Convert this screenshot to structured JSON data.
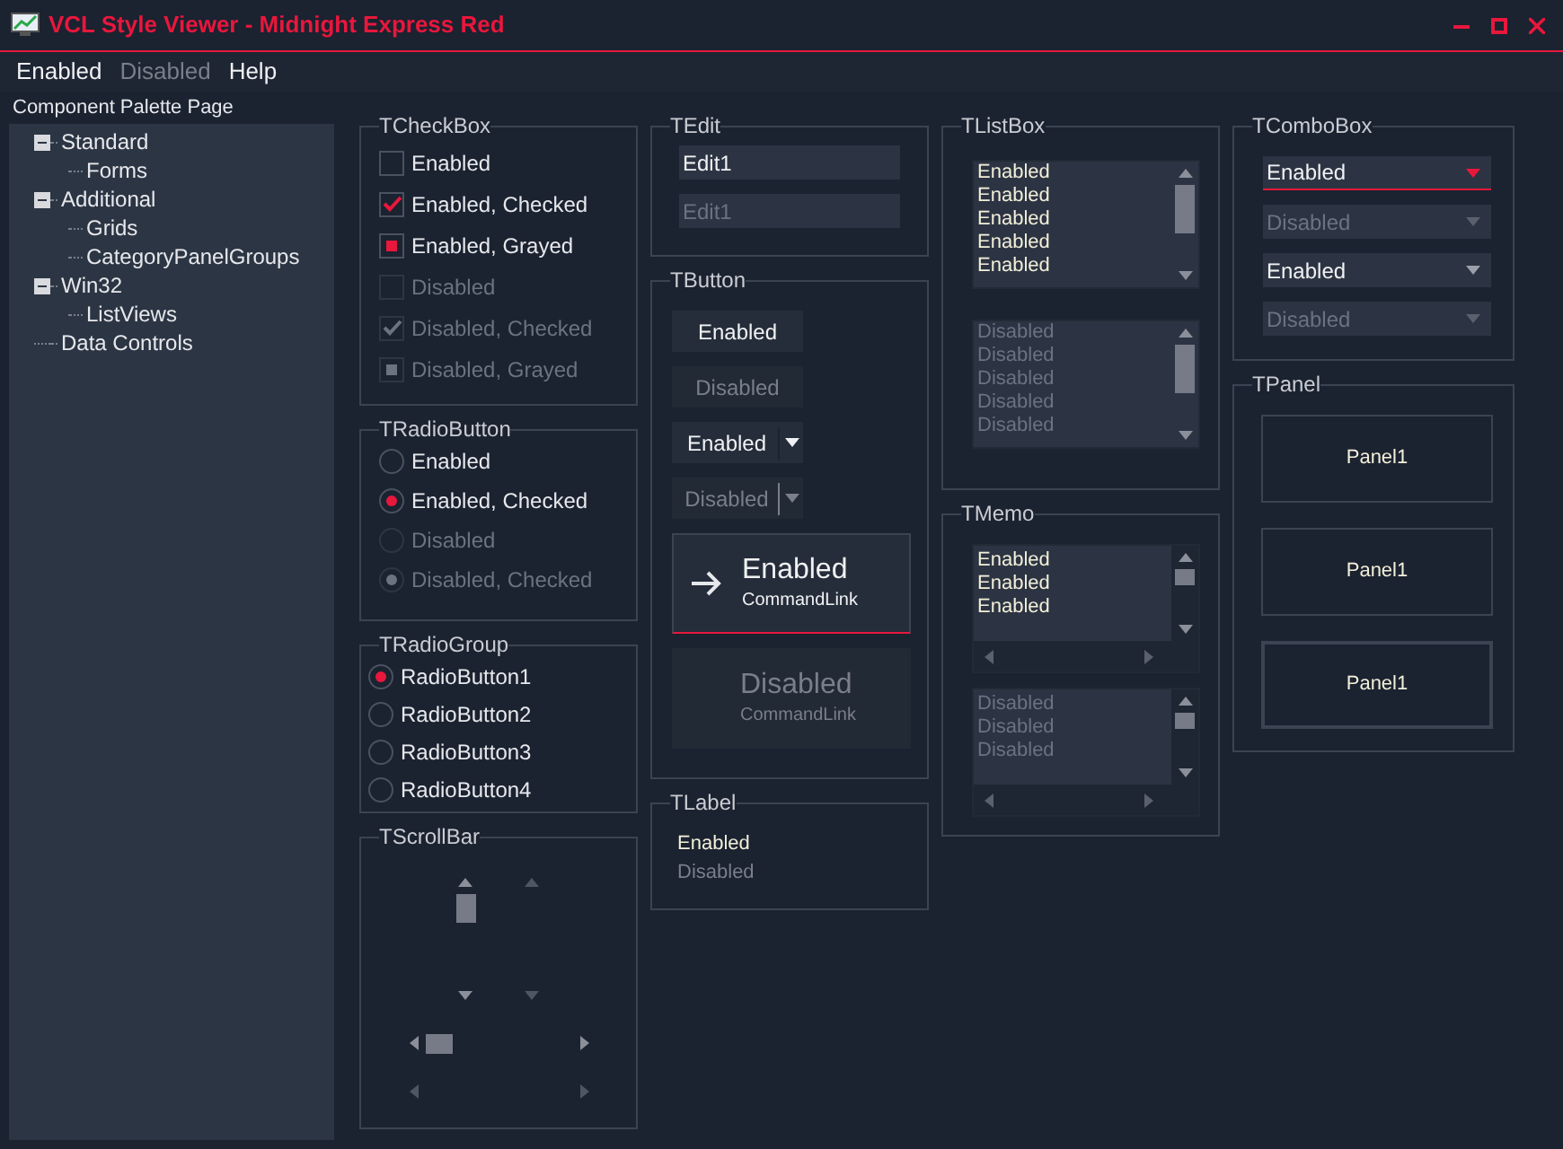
{
  "window": {
    "title": "VCL Style Viewer - Midnight Express Red"
  },
  "menu": [
    {
      "label": "Enabled",
      "disabled": false
    },
    {
      "label": "Disabled",
      "disabled": true
    },
    {
      "label": "Help",
      "disabled": false
    }
  ],
  "palette_label": "Component Palette Page",
  "tree": [
    {
      "label": "Standard",
      "expanded": true,
      "children": [
        {
          "label": "Forms"
        }
      ]
    },
    {
      "label": "Additional",
      "expanded": true,
      "children": [
        {
          "label": "Grids"
        },
        {
          "label": "CategoryPanelGroups"
        }
      ]
    },
    {
      "label": "Win32",
      "expanded": true,
      "children": [
        {
          "label": "ListViews"
        }
      ]
    },
    {
      "label": "Data Controls"
    }
  ],
  "checkbox_group": {
    "title": "TCheckBox",
    "items": [
      {
        "label": "Enabled",
        "checked": false,
        "grayed": false,
        "disabled": false
      },
      {
        "label": "Enabled, Checked",
        "checked": true,
        "grayed": false,
        "disabled": false
      },
      {
        "label": "Enabled, Grayed",
        "checked": false,
        "grayed": true,
        "disabled": false
      },
      {
        "label": "Disabled",
        "checked": false,
        "grayed": false,
        "disabled": true
      },
      {
        "label": "Disabled, Checked",
        "checked": true,
        "grayed": false,
        "disabled": true
      },
      {
        "label": "Disabled, Grayed",
        "checked": false,
        "grayed": true,
        "disabled": true
      }
    ]
  },
  "radio_button_group": {
    "title": "TRadioButton",
    "items": [
      {
        "label": "Enabled",
        "selected": false,
        "disabled": false
      },
      {
        "label": "Enabled, Checked",
        "selected": true,
        "disabled": false
      },
      {
        "label": "Disabled",
        "selected": false,
        "disabled": true
      },
      {
        "label": "Disabled, Checked",
        "selected": true,
        "disabled": true
      }
    ]
  },
  "radio_group": {
    "title": "TRadioGroup",
    "items": [
      {
        "label": "RadioButton1",
        "selected": true
      },
      {
        "label": "RadioButton2",
        "selected": false
      },
      {
        "label": "RadioButton3",
        "selected": false
      },
      {
        "label": "RadioButton4",
        "selected": false
      }
    ]
  },
  "scrollbar_group": {
    "title": "TScrollBar",
    "vertical_scrollbars": [
      {
        "disabled": false
      },
      {
        "disabled": true
      }
    ],
    "horizontal_scrollbars": [
      {
        "disabled": false
      },
      {
        "disabled": true
      }
    ]
  },
  "edit_group": {
    "title": "TEdit",
    "fields": [
      {
        "value": "Edit1",
        "disabled": false
      },
      {
        "value": "Edit1",
        "disabled": true
      }
    ]
  },
  "button_group": {
    "title": "TButton",
    "buttons": [
      {
        "kind": "push",
        "label": "Enabled",
        "disabled": false
      },
      {
        "kind": "push",
        "label": "Disabled",
        "disabled": true
      },
      {
        "kind": "split",
        "label": "Enabled",
        "disabled": false
      },
      {
        "kind": "split",
        "label": "Disabled",
        "disabled": true
      },
      {
        "kind": "command",
        "label": "Enabled",
        "note": "CommandLink",
        "disabled": false
      },
      {
        "kind": "command",
        "label": "Disabled",
        "note": "CommandLink",
        "disabled": true
      }
    ]
  },
  "label_group": {
    "title": "TLabel",
    "labels": [
      {
        "text": "Enabled",
        "disabled": false
      },
      {
        "text": "Disabled",
        "disabled": true
      }
    ]
  },
  "listbox_group": {
    "title": "TListBox",
    "lists": [
      {
        "disabled": false,
        "items": [
          "Enabled",
          "Enabled",
          "Enabled",
          "Enabled",
          "Enabled"
        ]
      },
      {
        "disabled": true,
        "items": [
          "Disabled",
          "Disabled",
          "Disabled",
          "Disabled",
          "Disabled"
        ]
      }
    ]
  },
  "memo_group": {
    "title": "TMemo",
    "memos": [
      {
        "disabled": false,
        "lines": [
          "Enabled",
          "Enabled",
          "Enabled"
        ]
      },
      {
        "disabled": true,
        "lines": [
          "Disabled",
          "Disabled",
          "Disabled"
        ]
      }
    ]
  },
  "combobox_group": {
    "title": "TComboBox",
    "combos": [
      {
        "value": "Enabled",
        "disabled": false,
        "focused": true
      },
      {
        "value": "Disabled",
        "disabled": true,
        "focused": false
      },
      {
        "value": "Enabled",
        "disabled": false,
        "focused": false
      },
      {
        "value": "Disabled",
        "disabled": true,
        "focused": false
      }
    ]
  },
  "panel_group": {
    "title": "TPanel",
    "panels": [
      {
        "label": "Panel1",
        "kind": "single"
      },
      {
        "label": "Panel1",
        "kind": "single"
      },
      {
        "label": "Panel1",
        "kind": "double"
      }
    ]
  }
}
